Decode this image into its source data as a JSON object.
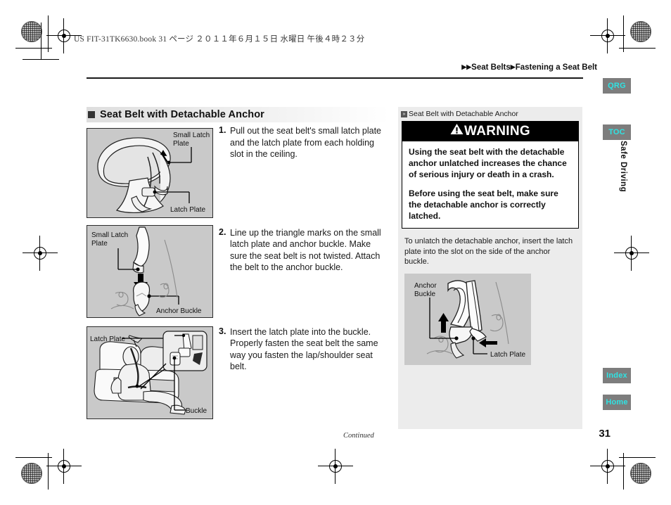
{
  "header": {
    "filestamp": "US FIT-31TK6630.book   31 ページ   ２０１１年６月１５日   水曜日   午後４時２３分",
    "breadcrumb_part1": "Seat Belts",
    "breadcrumb_part2": "Fastening a Seat Belt"
  },
  "tabs": {
    "qrg": "QRG",
    "toc": "TOC",
    "index": "Index",
    "home": "Home",
    "vertical_label": "Safe Driving"
  },
  "page_number": "31",
  "left": {
    "section_title": "Seat Belt with Detachable Anchor",
    "steps": [
      {
        "num": "1.",
        "text": "Pull out the seat belt's small latch plate and the latch plate from each holding slot in the ceiling."
      },
      {
        "num": "2.",
        "text": "Line up the triangle marks on the small latch plate and anchor buckle. Make sure the seat belt is not twisted. Attach the belt to the anchor buckle."
      },
      {
        "num": "3.",
        "text": "Insert the latch plate into the buckle. Properly fasten the seat belt the same way you fasten the lap/shoulder seat belt."
      }
    ],
    "figure1": {
      "label_top": "Small Latch",
      "label_top2": "Plate",
      "label_bottom": "Latch Plate"
    },
    "figure2": {
      "label_top": "Small Latch",
      "label_top2": "Plate",
      "label_bottom": "Anchor Buckle"
    },
    "figure3": {
      "label_top": "Latch Plate",
      "label_bottom": "Buckle"
    },
    "continued": "Continued"
  },
  "right": {
    "head_marker": "»",
    "head_title": "Seat Belt with Detachable Anchor",
    "warning_title": "WARNING",
    "warning_paragraphs": [
      "Using the seat belt with the detachable anchor unlatched increases the chance of serious injury or death in a crash.",
      "Before using the seat belt, make sure the detachable anchor is correctly latched."
    ],
    "note": "To unlatch the detachable anchor, insert the latch plate into the slot on the side of the anchor buckle.",
    "figure4": {
      "label_top": "Anchor",
      "label_top2": "Buckle",
      "label_bottom": "Latch Plate"
    }
  },
  "colors": {
    "tab_bg": "#7d7d7d",
    "tab_text": "#2fe3e3",
    "warning_bg": "#000000",
    "figure_bg": "#c9c9c9",
    "panel_bg": "#ececec"
  }
}
